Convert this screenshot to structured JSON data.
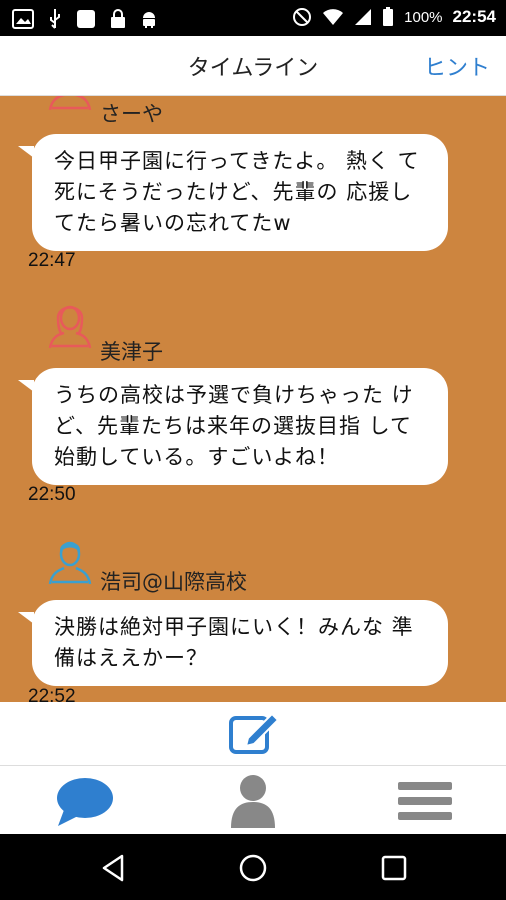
{
  "status_bar": {
    "battery": "100%",
    "time": "22:54"
  },
  "header": {
    "title": "タイムライン",
    "hint_label": "ヒント"
  },
  "colors": {
    "timeline_bg": "#cd853f",
    "accent": "#2f7fcf",
    "avatar_female": "#e85a5a",
    "avatar_male": "#3aa0d0"
  },
  "posts": [
    {
      "author": "さーや",
      "text": "今日甲子園に行ってきたよ。 熱く て死にそうだったけど、先輩の 応援してたら暑いの忘れてたw",
      "time": "22:47",
      "avatar_icon": "female-avatar-icon"
    },
    {
      "author": "美津子",
      "text": "うちの高校は予選で負けちゃった けど、先輩たちは来年の選抜目指 して始動している。すごいよね！",
      "time": "22:50",
      "avatar_icon": "female-avatar-icon"
    },
    {
      "author": "浩司@山際高校",
      "text": "決勝は絶対甲子園にいく！みんな 準備はええかー？",
      "time": "22:52",
      "avatar_icon": "male-avatar-icon"
    }
  ],
  "tabs": [
    {
      "name": "timeline",
      "icon": "speech-bubble-icon",
      "active": true
    },
    {
      "name": "profile",
      "icon": "person-icon",
      "active": false
    },
    {
      "name": "menu",
      "icon": "hamburger-menu-icon",
      "active": false
    }
  ]
}
